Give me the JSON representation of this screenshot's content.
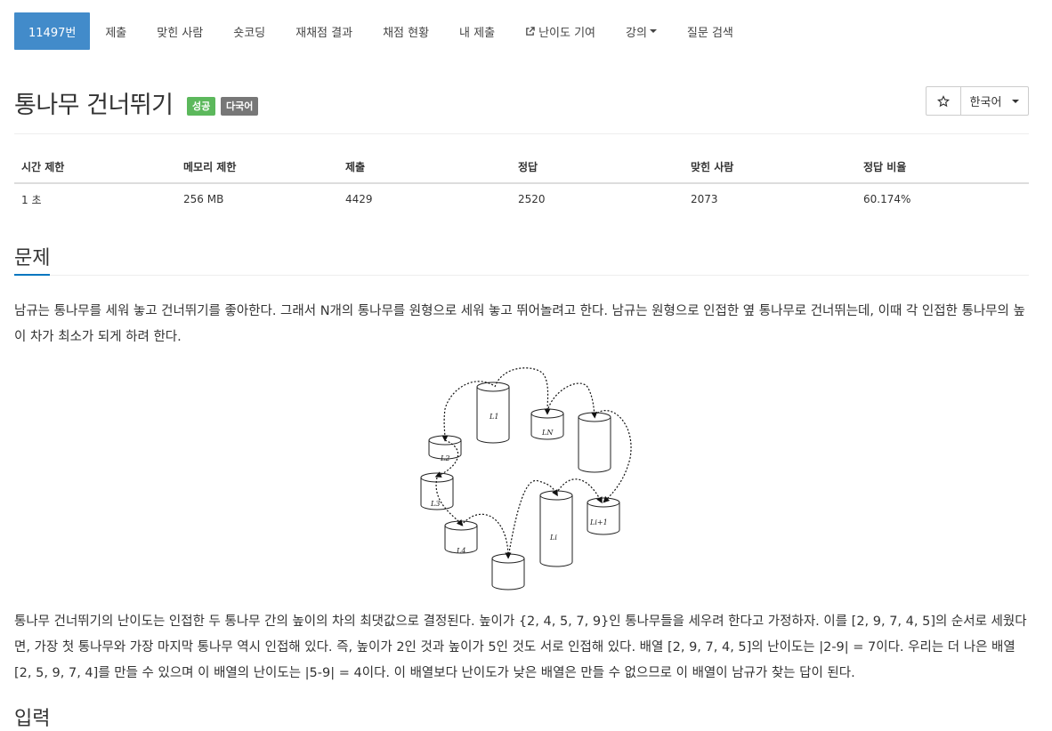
{
  "nav": {
    "tabs": [
      {
        "label": "11497번",
        "active": true
      },
      {
        "label": "제출"
      },
      {
        "label": "맞힌 사람"
      },
      {
        "label": "숏코딩"
      },
      {
        "label": "재채점 결과"
      },
      {
        "label": "채점 현황"
      },
      {
        "label": "내 제출"
      },
      {
        "label": "난이도 기여",
        "icon": "external-link-icon"
      },
      {
        "label": "강의",
        "dropdown": true
      },
      {
        "label": "질문 검색"
      }
    ]
  },
  "problem": {
    "title": "통나무 건너뛰기",
    "badge_success": "성공",
    "badge_multilang": "다국어",
    "star_icon": "star-outline-icon",
    "language": "한국어"
  },
  "info_table": {
    "headers": [
      "시간 제한",
      "메모리 제한",
      "제출",
      "정답",
      "맞힌 사람",
      "정답 비율"
    ],
    "values": [
      "1 초",
      "256 MB",
      "4429",
      "2520",
      "2073",
      "60.174%"
    ]
  },
  "section": {
    "title": "문제",
    "paragraph1": "남규는 통나무를 세워 놓고 건너뛰기를 좋아한다. 그래서 N개의 통나무를 원형으로 세워 놓고 뛰어놀려고 한다. 남규는 원형으로 인접한 옆 통나무로 건너뛰는데, 이때 각 인접한 통나무의 높이 차가 최소가 되게 하려 한다.",
    "paragraph2": "통나무 건너뛰기의 난이도는 인접한 두 통나무 간의 높이의 차의 최댓값으로 결정된다. 높이가 {2, 4, 5, 7, 9}인 통나무들을 세우려 한다고 가정하자. 이를 [2, 9, 7, 4, 5]의 순서로 세웠다면, 가장 첫 통나무와 가장 마지막 통나무 역시 인접해 있다. 즉, 높이가 2인 것과 높이가 5인 것도 서로 인접해 있다. 배열 [2, 9, 7, 4, 5]의 난이도는 |2-9| = 7이다. 우리는 더 나은 배열 [2, 5, 9, 7, 4]를 만들 수 있으며 이 배열의 난이도는 |5-9| = 4이다. 이 배열보다 난이도가 낮은 배열은 만들 수 없으므로 이 배열이 남규가 찾는 답이 된다.",
    "next_title": "입력"
  },
  "figure": {
    "labels": [
      "L1",
      "LN",
      "L2",
      "L3",
      "L4",
      "Li",
      "Li+1"
    ]
  }
}
